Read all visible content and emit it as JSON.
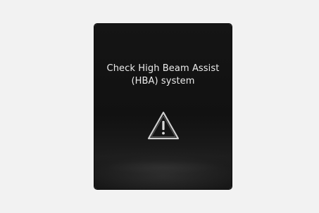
{
  "display": {
    "message_line1": "Check High Beam Assist",
    "message_line2": "(HBA) system",
    "icon": "warning-triangle-icon",
    "colors": {
      "page_background": "#f2f2f2",
      "screen_background": "#111111",
      "text": "#ececec",
      "icon_stroke": "#cfcfcf"
    }
  }
}
